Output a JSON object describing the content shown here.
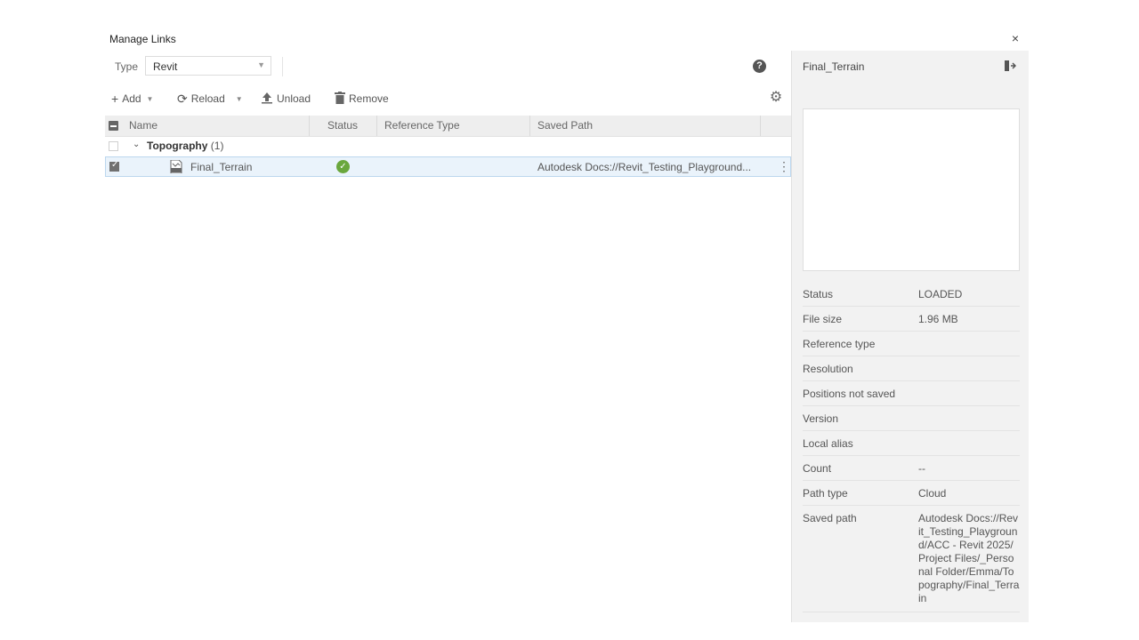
{
  "dialog": {
    "title": "Manage Links",
    "close": "×"
  },
  "filter": {
    "type_label": "Type",
    "type_value": "Revit"
  },
  "toolbar": {
    "add": "Add",
    "reload": "Reload",
    "unload": "Unload",
    "remove": "Remove"
  },
  "table": {
    "columns": [
      "Name",
      "Status",
      "Reference Type",
      "Saved Path"
    ],
    "groups": [
      {
        "name": "Topography",
        "count": "(1)",
        "rows": [
          {
            "name": "Final_Terrain",
            "status": "loaded",
            "reference_type": "",
            "saved_path": "Autodesk Docs://Revit_Testing_Playground..."
          }
        ]
      }
    ]
  },
  "details": {
    "title": "Final_Terrain",
    "props": [
      {
        "key": "Status",
        "value": "LOADED"
      },
      {
        "key": "File size",
        "value": "1.96 MB"
      },
      {
        "key": "Reference type",
        "value": ""
      },
      {
        "key": "Resolution",
        "value": ""
      },
      {
        "key": "Positions not saved",
        "value": ""
      },
      {
        "key": "Version",
        "value": ""
      },
      {
        "key": "Local alias",
        "value": ""
      },
      {
        "key": "Count",
        "value": "--"
      },
      {
        "key": "Path type",
        "value": "Cloud"
      },
      {
        "key": "Saved path",
        "value": "Autodesk Docs://Revit_Testing_Playground/ACC - Revit 2025/Project Files/_Personal Folder/Emma/Topography/Final_Terrain"
      }
    ]
  },
  "colors": {
    "status_ok": "#6aa73d",
    "selected_row": "#eaf3fb",
    "panel_bg": "#f2f2f2"
  },
  "icons": [
    "close-icon",
    "help-icon",
    "plus-icon",
    "reload-icon",
    "upload-icon",
    "trash-icon",
    "gear-icon",
    "chevron-down-icon",
    "file-icon",
    "check-circle-icon",
    "kebab-icon",
    "panel-collapse-icon"
  ]
}
